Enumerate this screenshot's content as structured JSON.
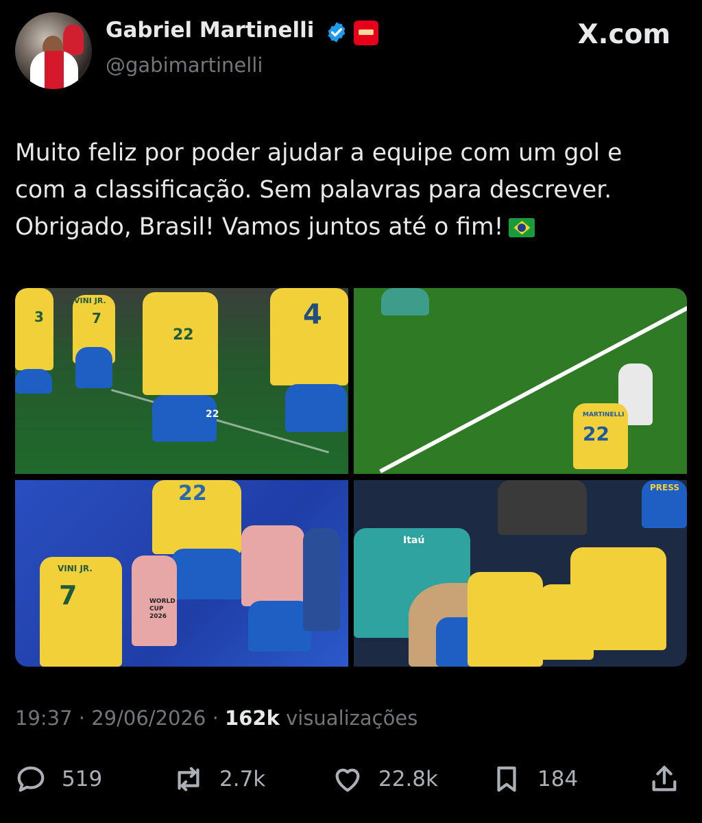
{
  "author": {
    "name": "Gabriel Martinelli",
    "handle": "@gabimartinelli",
    "verified": true
  },
  "site": "X.com",
  "tweet": {
    "lines": [
      "Muito feliz por poder ajudar a equipe com um gol e",
      "com a classificação. Sem palavras para descrever.",
      "Obrigado, Brasil! Vamos juntos até o fim!"
    ]
  },
  "photo_texts": {
    "p1_numbers": [
      "3",
      "7",
      "22",
      "4",
      "22"
    ],
    "p1_name": "VINI JR.",
    "p2_name": "MARTINELLI",
    "p2_number": "22",
    "p3_name": "VINI JR.",
    "p3_number": "7",
    "p3_top_number": "22",
    "p3_bib": "WORLD CUP 2026",
    "p4_sponsor": "Itaú",
    "p4_press": "PRESS"
  },
  "meta": {
    "time": "19:37",
    "date": "29/06/2026",
    "views_count": "162k",
    "views_label": "visualizações",
    "separator": "·"
  },
  "actions": {
    "replies": "519",
    "reposts": "2.7k",
    "likes": "22.8k",
    "bookmarks": "184"
  },
  "colors": {
    "background": "#000000",
    "text": "#e7e9ea",
    "muted": "#71767b",
    "verified_blue": "#1d9bf0",
    "club_red": "#e8001b"
  }
}
